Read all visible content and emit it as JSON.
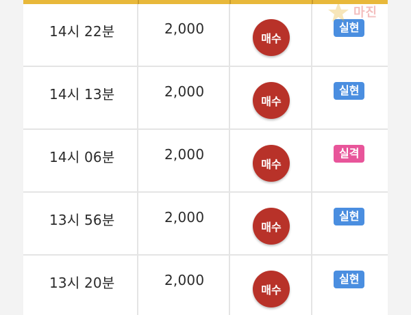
{
  "colors": {
    "header_accent": "#e8b83a",
    "buy_button": "#b83229",
    "badge_hit": "#4a8ee0",
    "badge_miss": "#e8559a"
  },
  "watermark": {
    "text": "마진"
  },
  "rows": [
    {
      "time": "14시 22분",
      "amount": "2,000",
      "action": "매수",
      "result": "실현",
      "result_color": "#4a8ee0"
    },
    {
      "time": "14시 13분",
      "amount": "2,000",
      "action": "매수",
      "result": "실현",
      "result_color": "#4a8ee0"
    },
    {
      "time": "14시 06분",
      "amount": "2,000",
      "action": "매수",
      "result": "실격",
      "result_color": "#e8559a"
    },
    {
      "time": "13시 56분",
      "amount": "2,000",
      "action": "매수",
      "result": "실현",
      "result_color": "#4a8ee0"
    },
    {
      "time": "13시 20분",
      "amount": "2,000",
      "action": "매수",
      "result": "실현",
      "result_color": "#4a8ee0"
    }
  ]
}
